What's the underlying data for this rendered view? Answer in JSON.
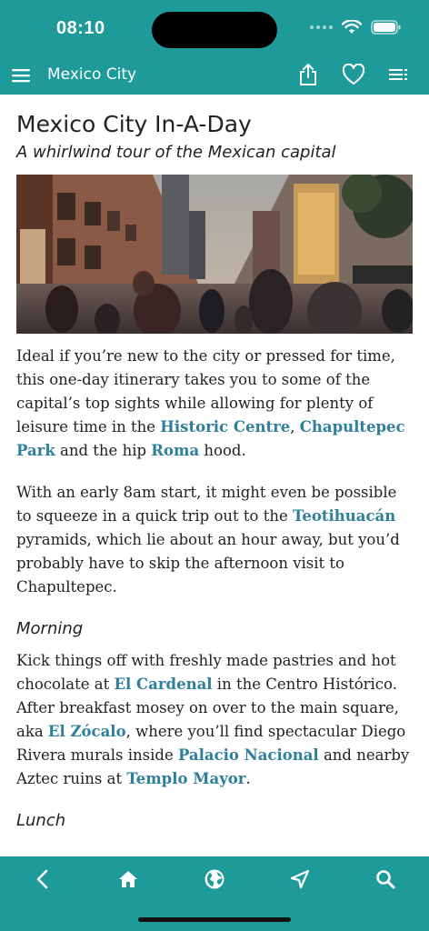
{
  "status_bar": {
    "time": "08:10"
  },
  "nav": {
    "title": "Mexico City",
    "icons": [
      "menu-icon",
      "share-icon",
      "heart-icon",
      "list-icon"
    ]
  },
  "article": {
    "title": "Mexico City In-A-Day",
    "subtitle": "A whirlwind tour of the Mexican capital",
    "p1": {
      "t1": "Ideal if you’re new to the city or pressed for time, this one-day itinerary takes you to some of the capital’s top sights while allowing for plenty of leisure time in the ",
      "l1": "Historic Centre",
      "t2": ", ",
      "l2": "Chapultepec Park",
      "t3": " and the hip ",
      "l3": "Roma",
      "t4": " hood."
    },
    "p2": {
      "t1": "With an early 8am start, it might even be possible to squeeze in a quick trip out to the ",
      "l1": "Teotihuacán",
      "t2": " pyramids, which lie about an hour away, but you’d probably have to skip the afternoon visit to Chapultepec."
    },
    "morning": {
      "heading": "Morning",
      "t1": "Kick things off with freshly made pastries and hot chocolate at ",
      "l1": "El Cardenal",
      "t2": " in the Centro Histórico. After breakfast mosey on over to the main square, aka ",
      "l2": "El Zócalo",
      "t3": ", where you’ll find spectacular Diego Rivera murals inside ",
      "l3": "Palacio Nacional",
      "t4": " and nearby Aztec ruins at ",
      "l4": "Templo Mayor",
      "t5": "."
    },
    "lunch": {
      "heading": "Lunch"
    }
  },
  "bottom_bar": {
    "icons": [
      "back-icon",
      "home-icon",
      "globe-icon",
      "navigate-icon",
      "search-icon"
    ]
  },
  "colors": {
    "brand": "#1f9a9b",
    "link": "#2e7f9c"
  }
}
